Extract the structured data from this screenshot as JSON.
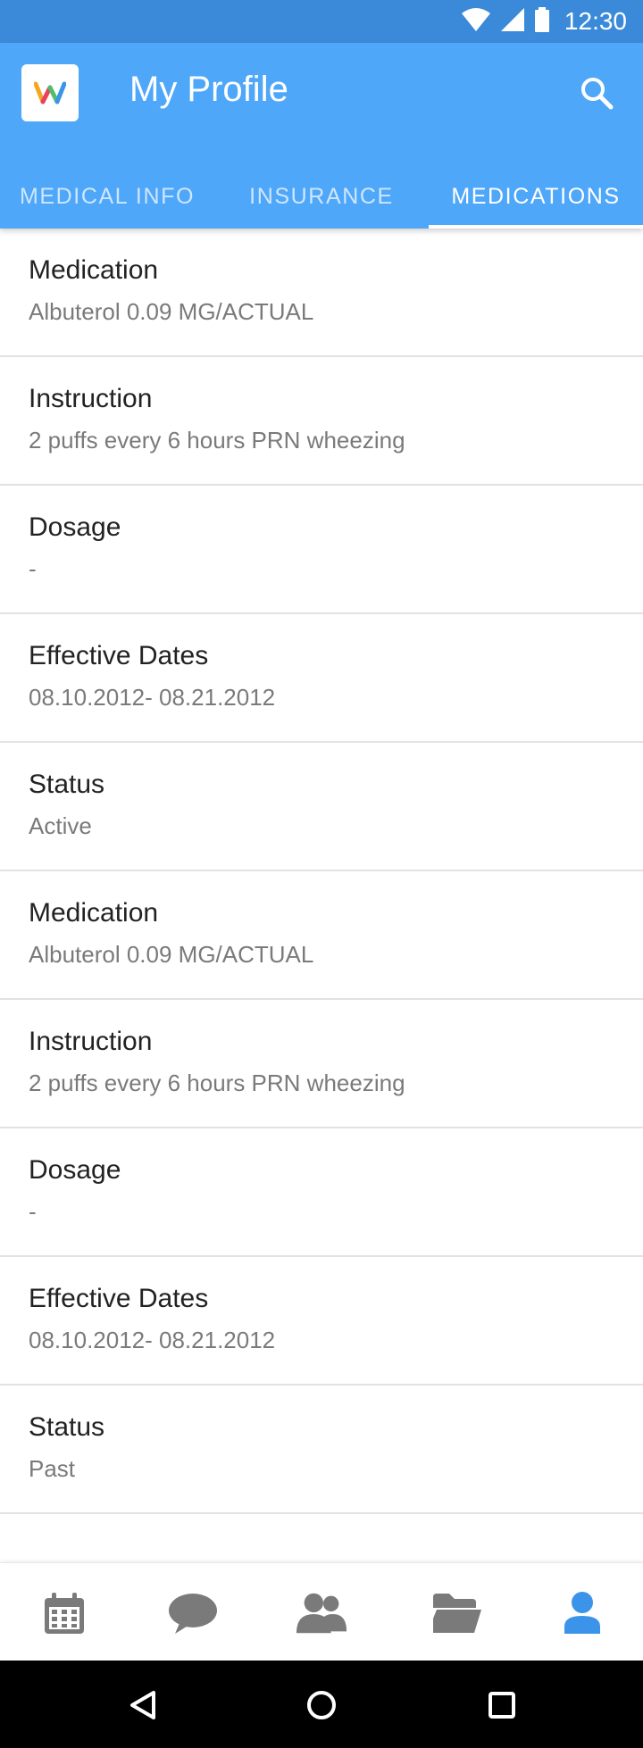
{
  "status_bar": {
    "time": "12:30"
  },
  "app_bar": {
    "logo_letter": "W",
    "title": "My Profile",
    "search_icon": "search-icon"
  },
  "tabs": [
    {
      "label": "MEDICAL INFO",
      "active": false
    },
    {
      "label": "INSURANCE",
      "active": false
    },
    {
      "label": "MEDICATIONS",
      "active": true
    }
  ],
  "records": [
    {
      "label": "Medication",
      "value": "Albuterol 0.09 MG/ACTUAL"
    },
    {
      "label": "Instruction",
      "value": "2 puffs every 6 hours PRN wheezing"
    },
    {
      "label": "Dosage",
      "value": "-"
    },
    {
      "label": "Effective Dates",
      "value": "08.10.2012- 08.21.2012"
    },
    {
      "label": "Status",
      "value": "Active"
    },
    {
      "label": "Medication",
      "value": "Albuterol 0.09 MG/ACTUAL"
    },
    {
      "label": "Instruction",
      "value": "2 puffs every 6 hours PRN wheezing"
    },
    {
      "label": "Dosage",
      "value": "-"
    },
    {
      "label": "Effective Dates",
      "value": "08.10.2012- 08.21.2012"
    },
    {
      "label": "Status",
      "value": "Past"
    }
  ],
  "bottom_nav": [
    {
      "icon": "calendar-icon",
      "active": false
    },
    {
      "icon": "chat-icon",
      "active": false
    },
    {
      "icon": "people-icon",
      "active": false
    },
    {
      "icon": "folder-icon",
      "active": false
    },
    {
      "icon": "profile-icon",
      "active": true
    }
  ],
  "colors": {
    "status_bar": "#3b8ad9",
    "app_bar": "#4fa7f9",
    "nav_inactive": "#7a7a7a",
    "nav_active": "#3b94ea"
  }
}
